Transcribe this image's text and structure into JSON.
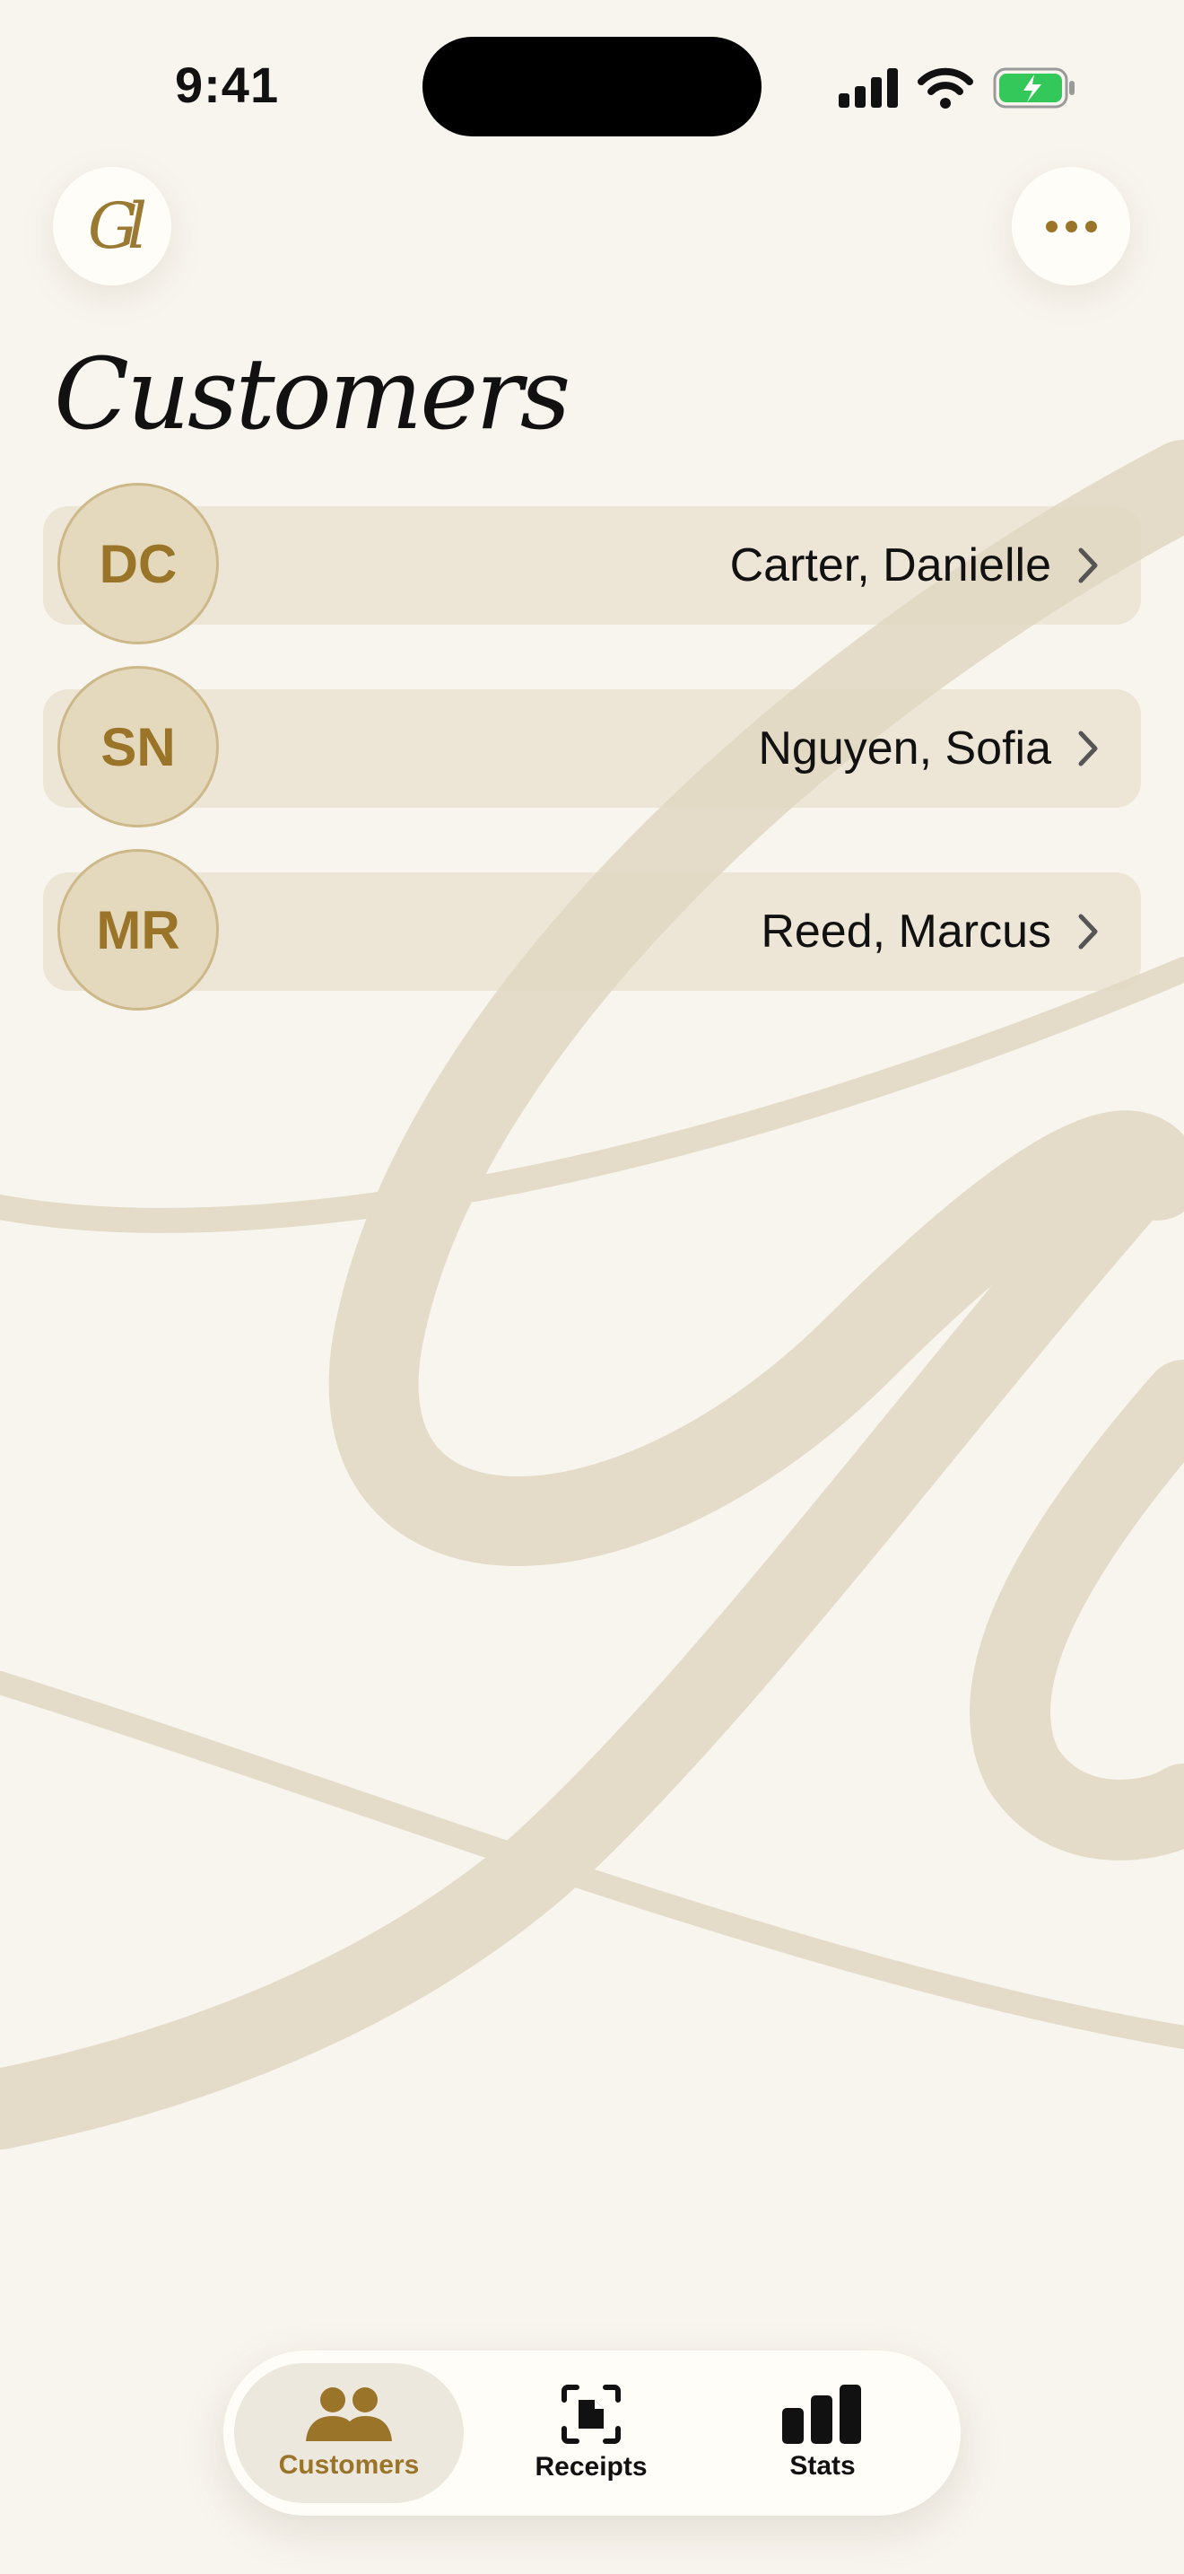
{
  "status": {
    "time": "9:41"
  },
  "header": {
    "logo_text": "Gl",
    "title": "Customers"
  },
  "customers": [
    {
      "initials": "DC",
      "name": "Carter, Danielle"
    },
    {
      "initials": "SN",
      "name": "Nguyen, Sofia"
    },
    {
      "initials": "MR",
      "name": "Reed, Marcus"
    }
  ],
  "tabs": [
    {
      "label": "Customers",
      "icon": "people-icon",
      "active": true
    },
    {
      "label": "Receipts",
      "icon": "receipt-scan-icon",
      "active": false
    },
    {
      "label": "Stats",
      "icon": "bar-chart-icon",
      "active": false
    }
  ],
  "colors": {
    "background": "#f8f5ef",
    "accent": "#9a7428",
    "row": "#ece5d6",
    "avatar": "#e5d9bd",
    "battery": "#34c759"
  }
}
